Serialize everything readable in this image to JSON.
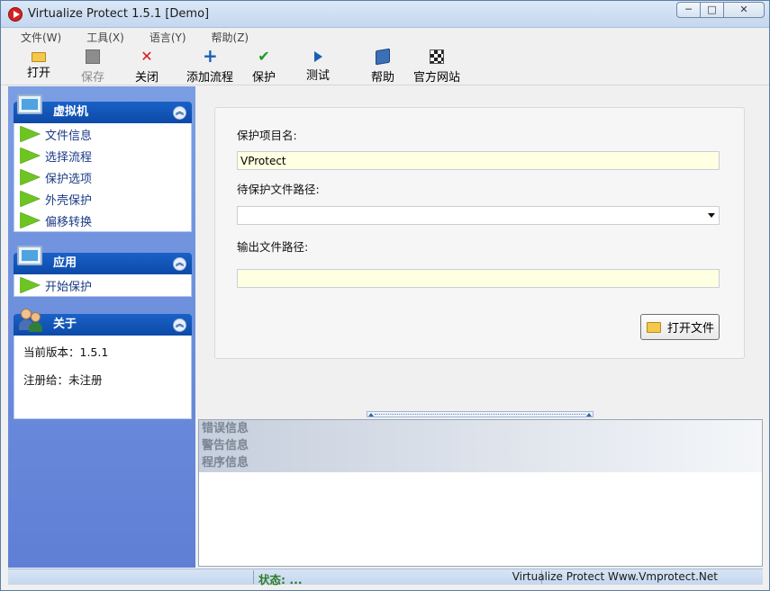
{
  "window": {
    "title": "Virtualize Protect 1.5.1 [Demo]",
    "controls": {
      "minimize": "─",
      "maximize": "□",
      "close": "✕"
    }
  },
  "menu": [
    "文件(W)",
    "工具(X)",
    "语言(Y)",
    "帮助(Z)"
  ],
  "toolbar": {
    "open": "打开",
    "save": "保存",
    "close": "关闭",
    "add_flow": "添加流程",
    "protect": "保护",
    "test": "测试",
    "help": "帮助",
    "website": "官方网站"
  },
  "sidebar": {
    "vm": {
      "title": "虚拟机",
      "items": [
        "文件信息",
        "选择流程",
        "保护选项",
        "外壳保护",
        "偏移转换"
      ]
    },
    "app": {
      "title": "应用",
      "items": [
        "开始保护"
      ]
    },
    "about": {
      "title": "关于",
      "version": "当前版本：1.5.1",
      "registered": "注册给：未注册"
    }
  },
  "form": {
    "project_name_label": "保护项目名:",
    "project_name_value": "VProtect",
    "file_path_label": "待保护文件路径:",
    "file_path_value": "",
    "output_path_label": "输出文件路径:",
    "output_path_value": "",
    "open_file_button": "打开文件"
  },
  "output": {
    "rows": [
      "错误信息",
      "警告信息",
      "程序信息"
    ]
  },
  "statusbar": {
    "status": "状态: ...",
    "credit": "Virtualize Protect Www.Vmprotect.Net"
  },
  "colors": {
    "accent": "#0c4aa8",
    "sidebar_bg": "#6a8bdc",
    "input_bg": "#ffffe1",
    "status_green": "#2e7d2a"
  }
}
